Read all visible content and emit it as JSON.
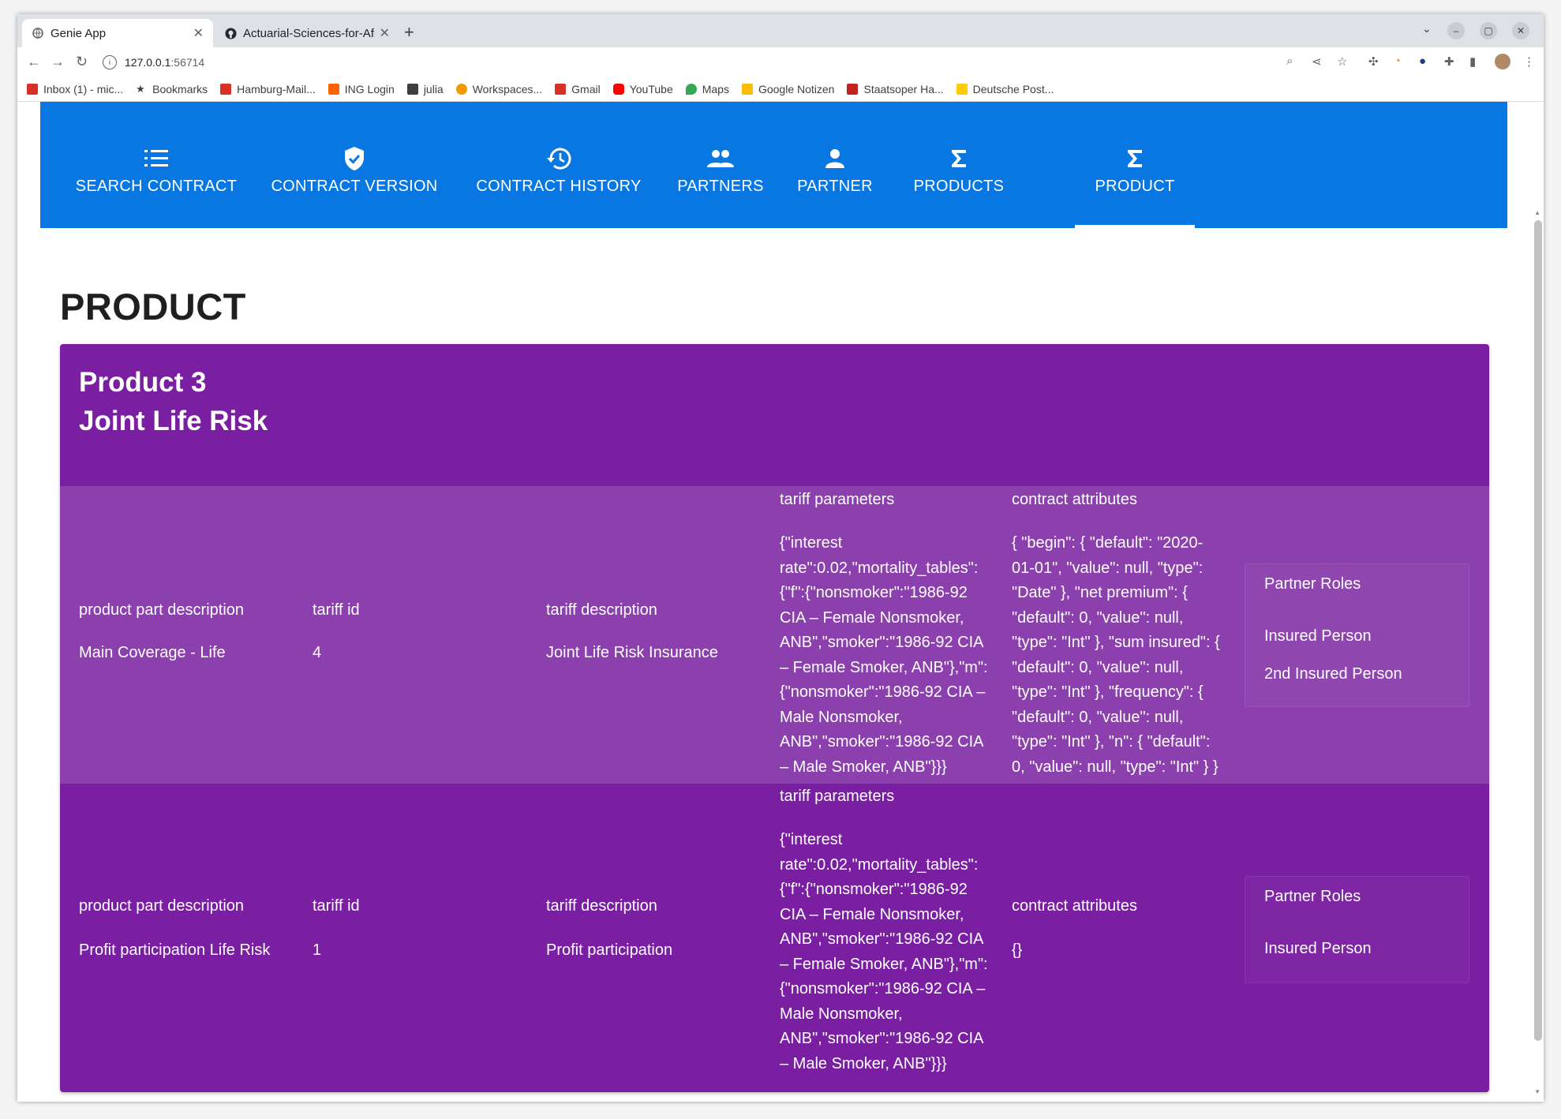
{
  "browser": {
    "tabs": [
      {
        "title": "Genie App",
        "active": true
      },
      {
        "title": "Actuarial-Sciences-for-Afr",
        "active": false
      }
    ],
    "url_host": "127.0.0.1",
    "url_port": ":56714",
    "bookmarks": [
      {
        "label": "Inbox (1) - mic...",
        "color": "#d93025"
      },
      {
        "label": "Bookmarks",
        "color": "#3c4043"
      },
      {
        "label": "Hamburg-Mail...",
        "color": "#d93025"
      },
      {
        "label": "ING Login",
        "color": "#ff6200"
      },
      {
        "label": "julia",
        "color": "#3c4043"
      },
      {
        "label": "Workspaces...",
        "color": "#f29900"
      },
      {
        "label": "Gmail",
        "color": "#d93025"
      },
      {
        "label": "YouTube",
        "color": "#ff0000"
      },
      {
        "label": "Maps",
        "color": "#34a853"
      },
      {
        "label": "Google Notizen",
        "color": "#fbbc04"
      },
      {
        "label": "Staatsoper Ha...",
        "color": "#c5221f"
      },
      {
        "label": "Deutsche Post...",
        "color": "#ffcc00"
      }
    ]
  },
  "nav": {
    "tabs": [
      {
        "label": "SEARCH CONTRACT",
        "icon": "list-icon"
      },
      {
        "label": "CONTRACT VERSION",
        "icon": "shield-check-icon"
      },
      {
        "label": "CONTRACT HISTORY",
        "icon": "history-icon"
      },
      {
        "label": "PARTNERS",
        "icon": "people-icon"
      },
      {
        "label": "PARTNER",
        "icon": "person-icon"
      },
      {
        "label": "PRODUCTS",
        "icon": "sigma-icon"
      },
      {
        "label": "PRODUCT",
        "icon": "sigma-icon",
        "selected": true
      }
    ]
  },
  "page": {
    "title": "PRODUCT",
    "product_line1": "Product 3",
    "product_line2": "Joint Life Risk"
  },
  "parts": [
    {
      "ppd_label": "product part description",
      "ppd_value": "Main Coverage - Life",
      "tariff_id_label": "tariff id",
      "tariff_id_value": "4",
      "tariff_desc_label": "tariff description",
      "tariff_desc_value": "Joint Life Risk Insurance",
      "tariff_params_label": "tariff parameters",
      "tariff_params_lines": [
        "{\"interest",
        "rate\":0.02,\"mortality_tables\":",
        "{\"f\":{\"nonsmoker\":\"1986-92",
        "CIA – Female Nonsmoker,",
        "ANB\",\"smoker\":\"1986-92 CIA",
        "– Female Smoker, ANB\"},\"m\":",
        "{\"nonsmoker\":\"1986-92 CIA –",
        "Male Nonsmoker,",
        "ANB\",\"smoker\":\"1986-92 CIA",
        "– Male Smoker, ANB\"}}}"
      ],
      "contract_attr_label": "contract attributes",
      "contract_attr_lines": [
        "{ \"begin\": { \"default\": \"2020-",
        "01-01\", \"value\": null, \"type\":",
        "\"Date\" }, \"net premium\": {",
        "\"default\": 0, \"value\": null,",
        "\"type\": \"Int\" }, \"sum insured\": {",
        "\"default\": 0, \"value\": null,",
        "\"type\": \"Int\" }, \"frequency\": {",
        "\"default\": 0, \"value\": null,",
        "\"type\": \"Int\" }, \"n\": { \"default\":",
        "0, \"value\": null, \"type\": \"Int\" } }"
      ],
      "partner_roles_label": "Partner Roles",
      "partner_roles": [
        "Insured Person",
        "2nd Insured Person"
      ]
    },
    {
      "ppd_label": "product part description",
      "ppd_value": "Profit participation Life Risk",
      "tariff_id_label": "tariff id",
      "tariff_id_value": "1",
      "tariff_desc_label": "tariff description",
      "tariff_desc_value": "Profit participation",
      "tariff_params_label": "tariff parameters",
      "tariff_params_lines": [
        "{\"interest",
        "rate\":0.02,\"mortality_tables\":",
        "{\"f\":{\"nonsmoker\":\"1986-92",
        "CIA – Female Nonsmoker,",
        "ANB\",\"smoker\":\"1986-92 CIA",
        "– Female Smoker, ANB\"},\"m\":",
        "{\"nonsmoker\":\"1986-92 CIA –",
        "Male Nonsmoker,",
        "ANB\",\"smoker\":\"1986-92 CIA",
        "– Male Smoker, ANB\"}}}"
      ],
      "contract_attr_label": "contract attributes",
      "contract_attr_value": "{}",
      "partner_roles_label": "Partner Roles",
      "partner_roles": [
        "Insured Person"
      ]
    }
  ],
  "colors": {
    "appbar": "#0877e1",
    "card": "#7a1fa2",
    "row_highlight": "#8c40ad"
  }
}
